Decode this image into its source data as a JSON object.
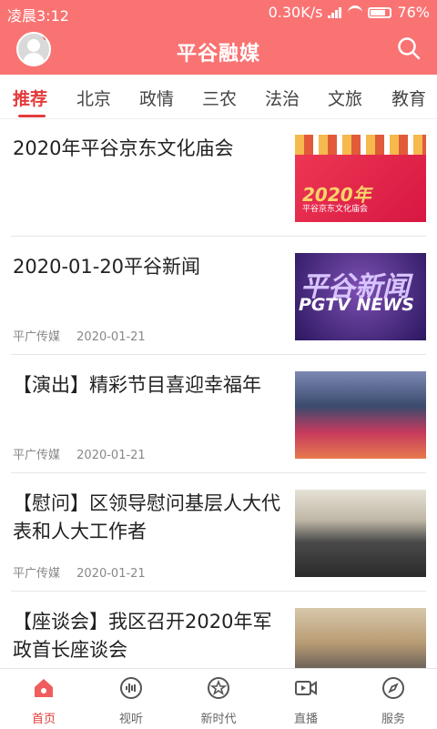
{
  "status_bar": {
    "time": "凌晨3:12",
    "network_speed": "0.30K/s",
    "battery": "76%"
  },
  "header": {
    "title": "平谷融媒"
  },
  "tabs": [
    {
      "label": "推荐"
    },
    {
      "label": "北京"
    },
    {
      "label": "政情"
    },
    {
      "label": "三农"
    },
    {
      "label": "法治"
    },
    {
      "label": "文旅"
    },
    {
      "label": "教育"
    }
  ],
  "articles": [
    {
      "title": "2020年平谷京东文化庙会",
      "source": "",
      "date": "",
      "thumb_text": {
        "year": "2020年",
        "caption": "平谷京东文化庙会"
      }
    },
    {
      "title": "2020-01-20平谷新闻",
      "source": "平广传媒",
      "date": "2020-01-21",
      "thumb_text": {
        "line1": "平谷新闻",
        "line2": "PGTV NEWS"
      }
    },
    {
      "title": "【演出】精彩节目喜迎幸福年",
      "source": "平广传媒",
      "date": "2020-01-21"
    },
    {
      "title": "【慰问】区领导慰问基层人大代表和人大工作者",
      "source": "平广传媒",
      "date": "2020-01-21"
    },
    {
      "title": "【座谈会】我区召开2020年军政首长座谈会",
      "source": "",
      "date": ""
    }
  ],
  "bottom_nav": [
    {
      "label": "首页",
      "icon": "home-icon"
    },
    {
      "label": "视听",
      "icon": "audio-icon"
    },
    {
      "label": "新时代",
      "icon": "star-badge-icon"
    },
    {
      "label": "直播",
      "icon": "video-icon"
    },
    {
      "label": "服务",
      "icon": "compass-icon"
    }
  ],
  "colors": {
    "brand": "#f97373",
    "accent": "#e33b3b"
  }
}
